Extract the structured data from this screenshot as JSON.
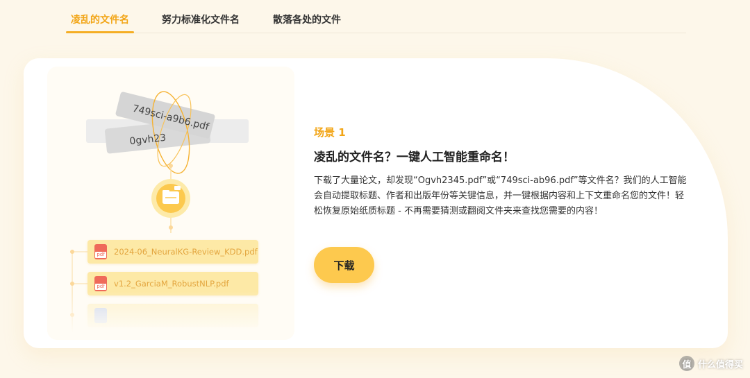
{
  "tabs": [
    {
      "label": "凌乱的文件名",
      "active": true
    },
    {
      "label": "努力标准化文件名",
      "active": false
    },
    {
      "label": "散落各处的文件",
      "active": false
    }
  ],
  "illustration": {
    "messy_names": [
      "749sci-a9b6.pdf",
      "0gvh23"
    ],
    "files": [
      {
        "name": "2024-06_NeuralKG-Review_KDD.pdf",
        "icon": "pdf"
      },
      {
        "name": "v1.2_GarciaM_RobustNLP.pdf",
        "icon": "pdf"
      }
    ],
    "pdf_icon_text": "pdf"
  },
  "content": {
    "scene_label": "场景 1",
    "headline": "凌乱的文件名？一键人工智能重命名！",
    "description": "下载了大量论文，却发现“Ogvh2345.pdf”或“749sci-ab96.pdf”等文件名？我们的人工智能会自动提取标题、作者和出版年份等关键信息，并一键根据内容和上下文重命名您的文件！轻松恢复原始纸质标题 - 不再需要猜测或翻阅文件夹来查找您需要的内容！",
    "download_label": "下载"
  },
  "watermark": {
    "text": "什么值得买",
    "icon_glyph": "值"
  },
  "colors": {
    "accent": "#f2a516",
    "button": "#fdc94e",
    "background": "#fdf7ea"
  }
}
